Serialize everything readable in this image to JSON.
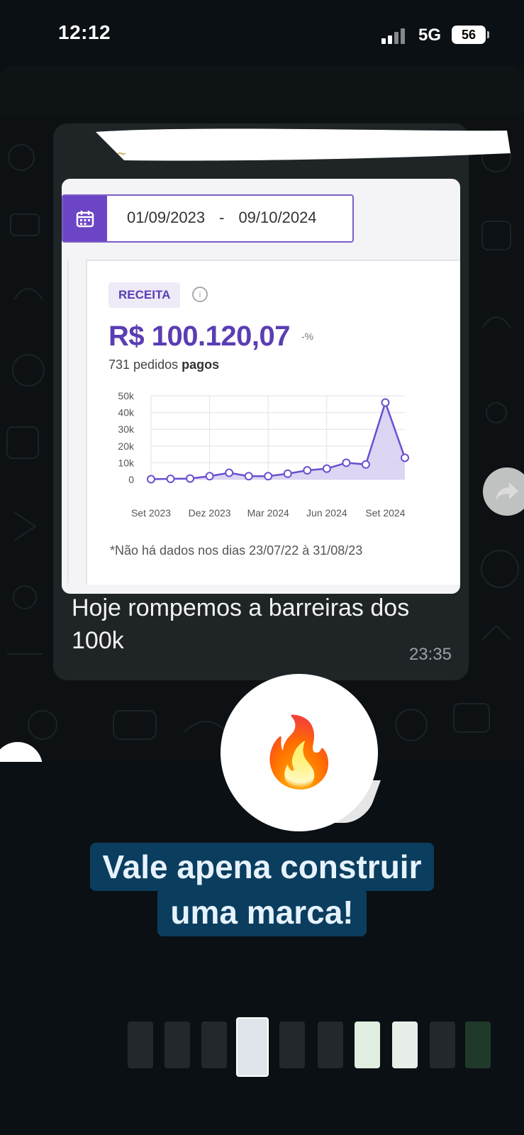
{
  "status_bar": {
    "time": "12:12",
    "network": "5G",
    "battery": "56"
  },
  "dashboard": {
    "date_start": "01/09/2023",
    "date_sep": "-",
    "date_end": "09/10/2024",
    "metric_badge": "RECEITA",
    "amount": "R$ 100.120,07",
    "change": "-%",
    "orders_prefix": "731 pedidos",
    "orders_suffix": "pagos",
    "footnote": "*Não há dados nos dias 23/07/22 à 31/08/23"
  },
  "chart_data": {
    "type": "area",
    "title": "",
    "xlabel": "",
    "ylabel": "",
    "ylim": [
      0,
      50000
    ],
    "y_ticks": [
      "0",
      "10k",
      "20k",
      "30k",
      "40k",
      "50k"
    ],
    "x_tick_labels": [
      "Set 2023",
      "Dez 2023",
      "Mar 2024",
      "Jun 2024",
      "Set 2024"
    ],
    "x": [
      "Set 2023",
      "Out 2023",
      "Nov 2023",
      "Dez 2023",
      "Jan 2024",
      "Fev 2024",
      "Mar 2024",
      "Abr 2024",
      "Mai 2024",
      "Jun 2024",
      "Jul 2024",
      "Ago 2024",
      "Set 2024",
      "Out 2024"
    ],
    "values": [
      200,
      400,
      600,
      2000,
      4000,
      2000,
      2000,
      3500,
      5500,
      6500,
      10000,
      9000,
      46000,
      13000
    ],
    "color": "#6b4fd0",
    "grid": true
  },
  "message": {
    "caption": "Hoje rompemos a barreiras dos 100k",
    "time": "23:35",
    "reaction": "👏🏻"
  },
  "sticker": {
    "emoji": "🔥"
  },
  "headline": {
    "line1": "Vale apena construir",
    "line2": "uma marca!"
  },
  "colors": {
    "accent": "#5b3db3",
    "headline_bg": "#0b3d5e",
    "headline_text": "#e6f3ff",
    "bubble": "#1f2427"
  },
  "icons": {
    "calendar": "calendar-icon",
    "info": "info-icon",
    "share": "forward-icon"
  }
}
